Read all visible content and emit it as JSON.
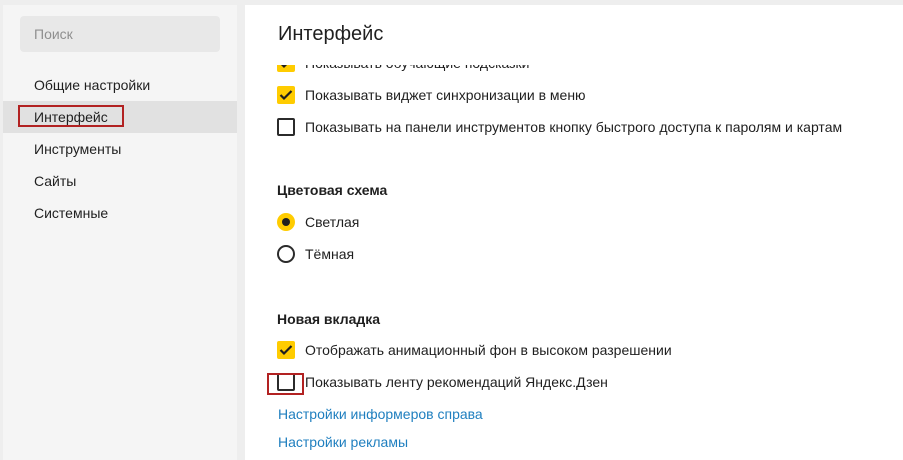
{
  "sidebar": {
    "search": {
      "placeholder": "Поиск",
      "value": ""
    },
    "items": [
      {
        "label": "Общие настройки",
        "active": false
      },
      {
        "label": "Интерфейс",
        "active": true
      },
      {
        "label": "Инструменты",
        "active": false
      },
      {
        "label": "Сайты",
        "active": false
      },
      {
        "label": "Системные",
        "active": false
      }
    ]
  },
  "main": {
    "title": "Интерфейс",
    "options_top": [
      {
        "label": "Показывать обучающие подсказки",
        "checked": true
      },
      {
        "label": "Показывать виджет синхронизации в меню",
        "checked": true
      },
      {
        "label": "Показывать на панели инструментов кнопку быстрого доступа к паролям и картам",
        "checked": false
      }
    ],
    "color_scheme": {
      "title": "Цветовая схема",
      "options": [
        {
          "label": "Светлая",
          "selected": true
        },
        {
          "label": "Тёмная",
          "selected": false
        }
      ]
    },
    "new_tab": {
      "title": "Новая вкладка",
      "options": [
        {
          "label": "Отображать анимационный фон в высоком разрешении",
          "checked": true
        },
        {
          "label": "Показывать ленту рекомендаций Яндекс.Дзен",
          "checked": false
        }
      ]
    },
    "links": [
      {
        "label": "Настройки информеров справа"
      },
      {
        "label": "Настройки рекламы"
      }
    ]
  },
  "colors": {
    "accent": "#ffcc00",
    "link": "#1f7fbf",
    "highlight_box": "#b22222"
  }
}
